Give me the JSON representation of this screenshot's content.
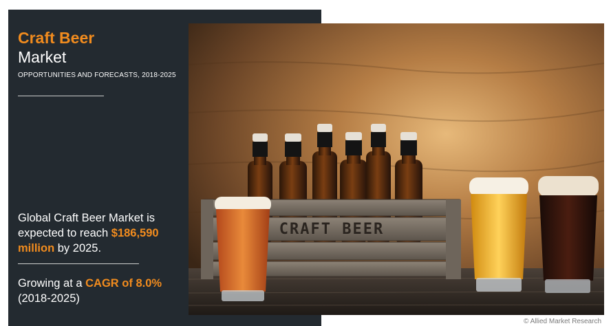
{
  "header": {
    "title_line1": "Craft Beer",
    "title_line2": "Market",
    "subtitle": "OPPORTUNITIES AND FORECASTS, 2018-2025"
  },
  "market": {
    "text_before": "Global Craft Beer Market is expected to reach ",
    "highlight": "$186,590 million",
    "text_after": " by 2025."
  },
  "growth": {
    "text_before": "Growing at a ",
    "highlight": "CAGR of 8.0%",
    "text_after": " (2018-2025)"
  },
  "photo": {
    "crate_label": "CRAFT BEER"
  },
  "footer": {
    "credit": "© Allied Market Research"
  },
  "colors": {
    "panel": "#232a30",
    "accent": "#f28c1e"
  }
}
